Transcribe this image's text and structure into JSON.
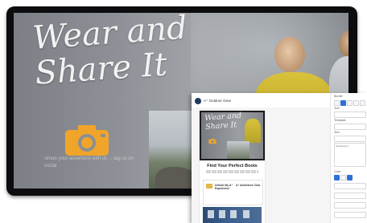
{
  "hero": {
    "title_line1": "Wear and",
    "title_line2": "Share It",
    "caption": "Share your adventure with us ... tag us on social"
  },
  "editor": {
    "app_title": "A⁺ Outdoor Gear",
    "email": {
      "hero_title_line1": "Wear and",
      "hero_title_line2": "Share It",
      "section_title": "Find Your Perfect Boots",
      "card_left": "Unlock My A⁺ Experience",
      "card_right": "A⁺ Adventure Club"
    },
    "properties": {
      "section_label": "Border",
      "label_a": "Text",
      "label_b": "Template",
      "label_c": "Text",
      "label_d": "Color",
      "textarea_value": "background"
    }
  },
  "colors": {
    "accent": "#2f6fd6",
    "camera": "#f0a52a",
    "monitor_bezel": "#0d0d0f"
  }
}
